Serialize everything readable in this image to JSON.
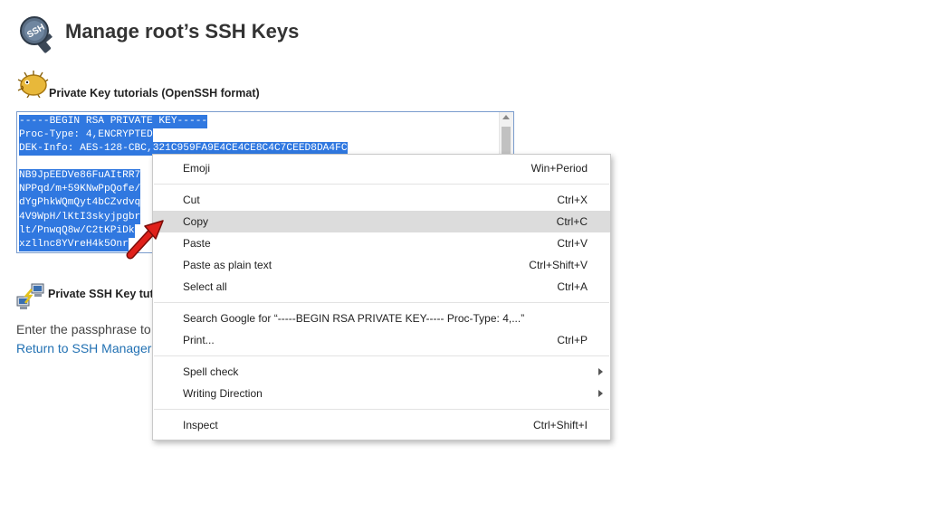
{
  "page": {
    "title": "Manage root’s SSH Keys"
  },
  "private_key": {
    "heading": "Private Key tutorials (OpenSSH format)",
    "lines": [
      "-----BEGIN RSA PRIVATE KEY-----",
      "Proc-Type: 4,ENCRYPTED",
      "DEK-Info: AES-128-CBC,321C959FA9E4CE4CE8C4C7CEED8DA4FC",
      " ",
      "NB9JpEEDVe86FuAItRR7",
      "NPPqd/m+59KNwPpQofe/",
      "dYgPhkWQmQyt4bCZvdvq",
      "4V9WpH/lKtI3skyjpgbr",
      "lt/PnwqQ8w/C2tKPiDk",
      "xzllnc8YVreH4k5Onr"
    ]
  },
  "ssh_key": {
    "heading": "Private SSH Key tut",
    "passphrase_text": "Enter the passphrase to",
    "return_link": "Return to SSH Manager"
  },
  "context_menu": {
    "items": [
      {
        "label": "Emoji",
        "shortcut": "Win+Period"
      },
      {
        "label": "Cut",
        "shortcut": "Ctrl+X"
      },
      {
        "label": "Copy",
        "shortcut": "Ctrl+C",
        "highlighted": true
      },
      {
        "label": "Paste",
        "shortcut": "Ctrl+V"
      },
      {
        "label": "Paste as plain text",
        "shortcut": "Ctrl+Shift+V"
      },
      {
        "label": "Select all",
        "shortcut": "Ctrl+A"
      },
      {
        "label": "Search Google for “-----BEGIN RSA PRIVATE KEY----- Proc-Type: 4,...”",
        "shortcut": ""
      },
      {
        "label": "Print...",
        "shortcut": "Ctrl+P"
      },
      {
        "label": "Spell check",
        "shortcut": "",
        "submenu": true
      },
      {
        "label": "Writing Direction",
        "shortcut": "",
        "submenu": true
      },
      {
        "label": "Inspect",
        "shortcut": "Ctrl+Shift+I"
      }
    ]
  },
  "colors": {
    "selection": "#3078e0",
    "link": "#2271b3",
    "highlight_row": "#dcdcdc",
    "annotation_arrow": "#e0201a"
  },
  "icons": {
    "page": "ssh-key-icon",
    "private_key": "pufferfish-icon",
    "ssh_key": "network-computers-icon",
    "annotation": "red-arrow-icon"
  }
}
